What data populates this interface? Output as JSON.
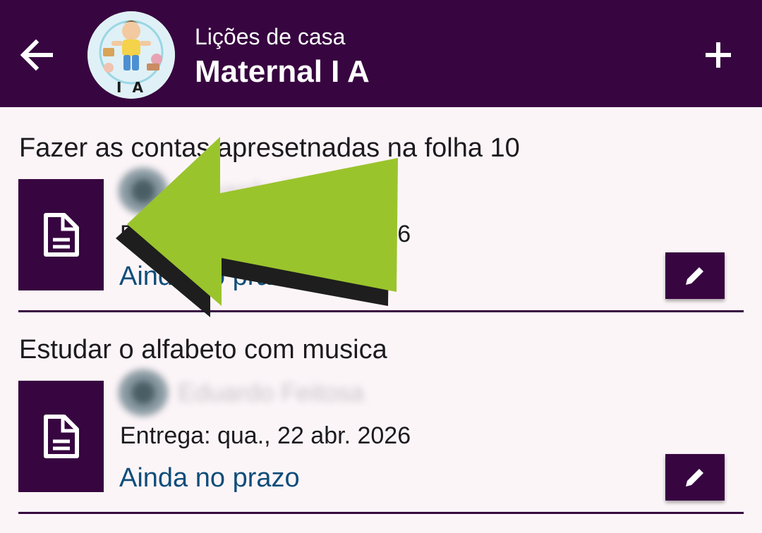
{
  "header": {
    "subtitle": "Lições de casa",
    "title": "Maternal I A",
    "avatar_label": "I A",
    "back_icon": "arrow-back-icon",
    "add_icon": "plus-icon"
  },
  "lessons": [
    {
      "title": "Fazer as contas apresetnadas na folha 10",
      "student_name": "Eduardo Feitosa",
      "due": "Entrega: qua., 22 abr. 2026",
      "status": "Ainda no prazo"
    },
    {
      "title": "Estudar o alfabeto com musica",
      "student_name": "Eduardo Feitosa",
      "due": "Entrega: qua., 22 abr. 2026",
      "status": "Ainda no prazo"
    }
  ],
  "colors": {
    "primary": "#370540",
    "background": "#fcf5f8",
    "status": "#0f4d7a",
    "arrow_overlay": "#9ac42c"
  }
}
